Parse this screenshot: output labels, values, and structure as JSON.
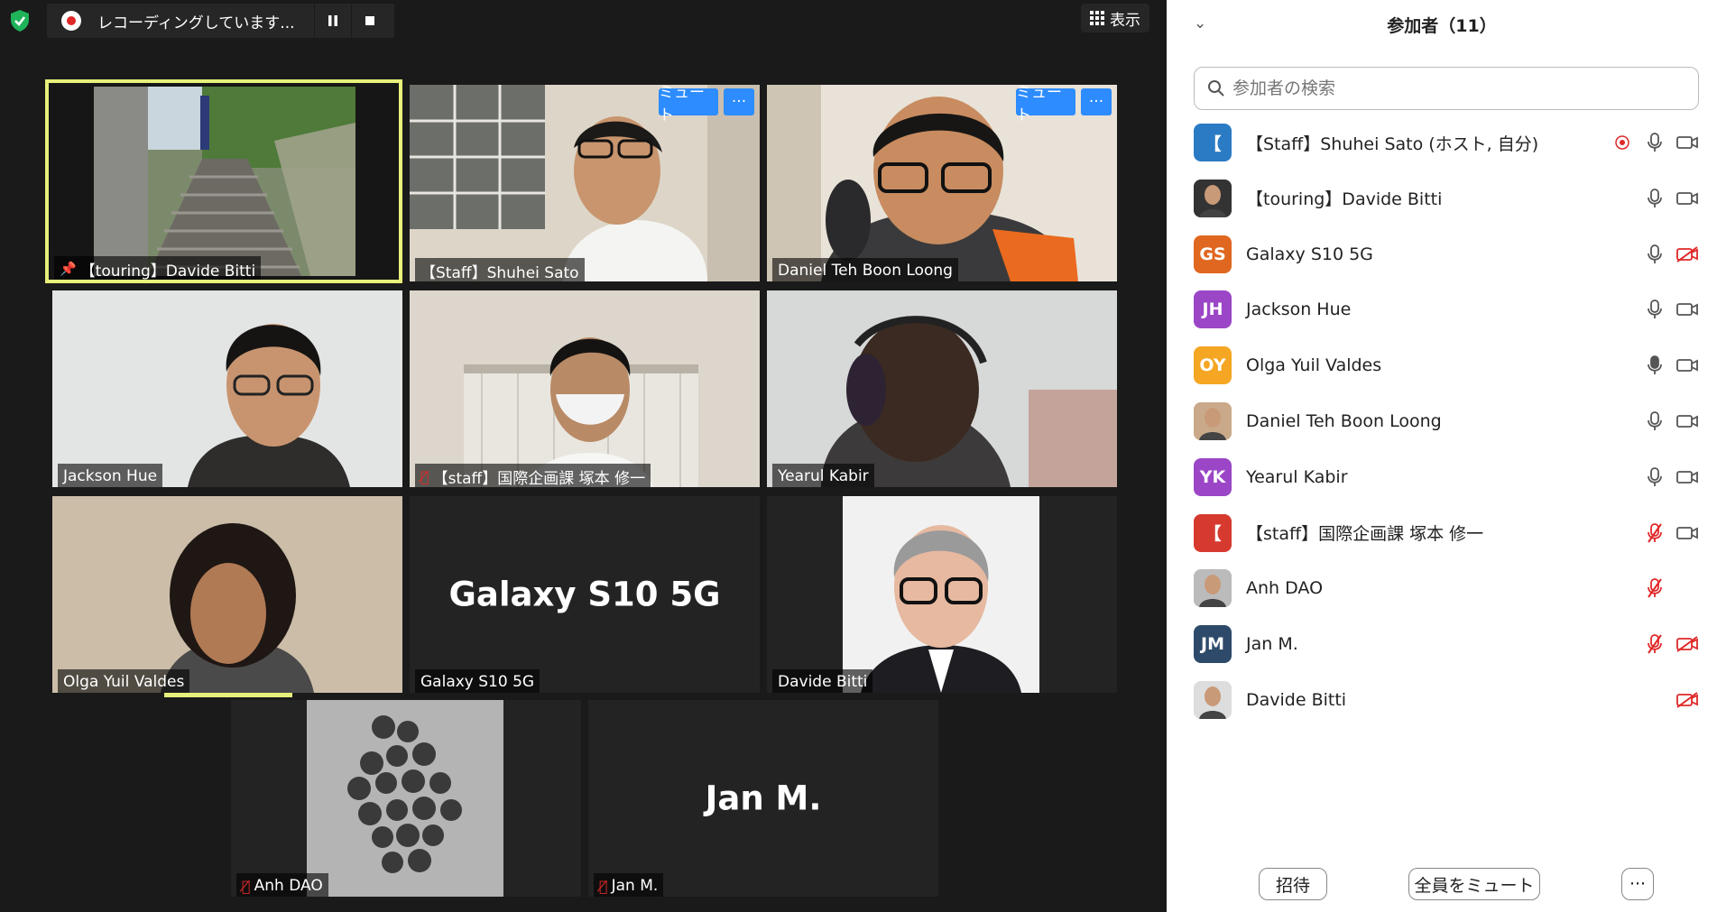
{
  "recording": {
    "status_text": "レコーディングしています...",
    "pause_icon": "pause-icon",
    "stop_icon": "stop-icon"
  },
  "view_button": {
    "label": "表示",
    "icon": "grid-view-icon"
  },
  "tiles": {
    "t1": {
      "name": "【touring】Davide Bitti"
    },
    "t2": {
      "name": "【Staff】Shuhei Sato",
      "mute_label": "ミュート",
      "more_label": "···"
    },
    "t3": {
      "name": "Daniel Teh Boon Loong",
      "mute_label": "ミュート",
      "more_label": "···"
    },
    "t4": {
      "name": "Jackson Hue"
    },
    "t5": {
      "name": "【staff】国際企画課 塚本 修一"
    },
    "t6": {
      "name": "Yearul Kabir"
    },
    "t7": {
      "name": "Olga Yuil Valdes"
    },
    "t8": {
      "name": "Galaxy S10 5G",
      "center_name": "Galaxy S10 5G"
    },
    "t9": {
      "name": "Davide Bitti"
    },
    "t10": {
      "name": "Anh DAO"
    },
    "t11": {
      "name": "Jan M.",
      "center_name": "Jan M."
    }
  },
  "sidebar": {
    "title": "参加者（11）",
    "search_placeholder": "参加者の検索",
    "participants": [
      {
        "initials": "【",
        "color": "#2b7bc4",
        "name": "【Staff】Shuhei Sato (ホスト, 自分)",
        "recording": true,
        "mic": "on",
        "video": "on"
      },
      {
        "initials": "",
        "color": "#333333",
        "name": "【touring】Davide Bitti",
        "recording": false,
        "mic": "on",
        "video": "on"
      },
      {
        "initials": "GS",
        "color": "#e0671f",
        "name": "Galaxy S10 5G",
        "recording": false,
        "mic": "on",
        "video": "off"
      },
      {
        "initials": "JH",
        "color": "#9b46c7",
        "name": "Jackson Hue",
        "recording": false,
        "mic": "on",
        "video": "on"
      },
      {
        "initials": "OY",
        "color": "#f5a623",
        "name": "Olga Yuil Valdes",
        "recording": false,
        "mic": "active",
        "video": "on"
      },
      {
        "initials": "",
        "color": "#c9a98a",
        "name": "Daniel Teh Boon Loong",
        "recording": false,
        "mic": "on",
        "video": "on"
      },
      {
        "initials": "YK",
        "color": "#9b46c7",
        "name": "Yearul Kabir",
        "recording": false,
        "mic": "on",
        "video": "on"
      },
      {
        "initials": "【",
        "color": "#d63a2f",
        "name": "【staff】国際企画課 塚本 修一",
        "recording": false,
        "mic": "off",
        "video": "on"
      },
      {
        "initials": "",
        "color": "#bbbbbb",
        "name": "Anh DAO",
        "recording": false,
        "mic": "off",
        "video": "none"
      },
      {
        "initials": "JM",
        "color": "#2e4a6b",
        "name": "Jan M.",
        "recording": false,
        "mic": "off",
        "video": "off"
      },
      {
        "initials": "",
        "color": "#dddddd",
        "name": "Davide Bitti",
        "recording": false,
        "mic": "none",
        "video": "off"
      }
    ],
    "footer": {
      "invite": "招待",
      "mute_all": "全員をミュート",
      "more": "···"
    }
  }
}
